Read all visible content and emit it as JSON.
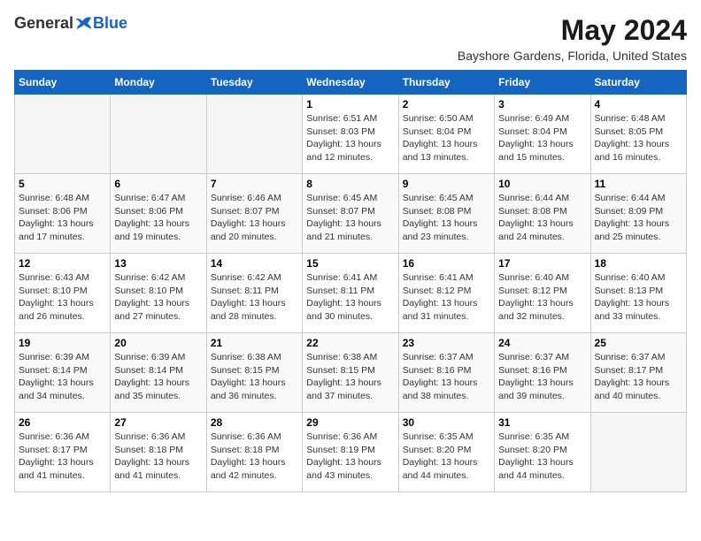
{
  "logo": {
    "general": "General",
    "blue": "Blue"
  },
  "title": "May 2024",
  "subtitle": "Bayshore Gardens, Florida, United States",
  "days_of_week": [
    "Sunday",
    "Monday",
    "Tuesday",
    "Wednesday",
    "Thursday",
    "Friday",
    "Saturday"
  ],
  "weeks": [
    [
      {
        "day": "",
        "info": ""
      },
      {
        "day": "",
        "info": ""
      },
      {
        "day": "",
        "info": ""
      },
      {
        "day": "1",
        "info": "Sunrise: 6:51 AM\nSunset: 8:03 PM\nDaylight: 13 hours and 12 minutes."
      },
      {
        "day": "2",
        "info": "Sunrise: 6:50 AM\nSunset: 8:04 PM\nDaylight: 13 hours and 13 minutes."
      },
      {
        "day": "3",
        "info": "Sunrise: 6:49 AM\nSunset: 8:04 PM\nDaylight: 13 hours and 15 minutes."
      },
      {
        "day": "4",
        "info": "Sunrise: 6:48 AM\nSunset: 8:05 PM\nDaylight: 13 hours and 16 minutes."
      }
    ],
    [
      {
        "day": "5",
        "info": "Sunrise: 6:48 AM\nSunset: 8:06 PM\nDaylight: 13 hours and 17 minutes."
      },
      {
        "day": "6",
        "info": "Sunrise: 6:47 AM\nSunset: 8:06 PM\nDaylight: 13 hours and 19 minutes."
      },
      {
        "day": "7",
        "info": "Sunrise: 6:46 AM\nSunset: 8:07 PM\nDaylight: 13 hours and 20 minutes."
      },
      {
        "day": "8",
        "info": "Sunrise: 6:45 AM\nSunset: 8:07 PM\nDaylight: 13 hours and 21 minutes."
      },
      {
        "day": "9",
        "info": "Sunrise: 6:45 AM\nSunset: 8:08 PM\nDaylight: 13 hours and 23 minutes."
      },
      {
        "day": "10",
        "info": "Sunrise: 6:44 AM\nSunset: 8:08 PM\nDaylight: 13 hours and 24 minutes."
      },
      {
        "day": "11",
        "info": "Sunrise: 6:44 AM\nSunset: 8:09 PM\nDaylight: 13 hours and 25 minutes."
      }
    ],
    [
      {
        "day": "12",
        "info": "Sunrise: 6:43 AM\nSunset: 8:10 PM\nDaylight: 13 hours and 26 minutes."
      },
      {
        "day": "13",
        "info": "Sunrise: 6:42 AM\nSunset: 8:10 PM\nDaylight: 13 hours and 27 minutes."
      },
      {
        "day": "14",
        "info": "Sunrise: 6:42 AM\nSunset: 8:11 PM\nDaylight: 13 hours and 28 minutes."
      },
      {
        "day": "15",
        "info": "Sunrise: 6:41 AM\nSunset: 8:11 PM\nDaylight: 13 hours and 30 minutes."
      },
      {
        "day": "16",
        "info": "Sunrise: 6:41 AM\nSunset: 8:12 PM\nDaylight: 13 hours and 31 minutes."
      },
      {
        "day": "17",
        "info": "Sunrise: 6:40 AM\nSunset: 8:12 PM\nDaylight: 13 hours and 32 minutes."
      },
      {
        "day": "18",
        "info": "Sunrise: 6:40 AM\nSunset: 8:13 PM\nDaylight: 13 hours and 33 minutes."
      }
    ],
    [
      {
        "day": "19",
        "info": "Sunrise: 6:39 AM\nSunset: 8:14 PM\nDaylight: 13 hours and 34 minutes."
      },
      {
        "day": "20",
        "info": "Sunrise: 6:39 AM\nSunset: 8:14 PM\nDaylight: 13 hours and 35 minutes."
      },
      {
        "day": "21",
        "info": "Sunrise: 6:38 AM\nSunset: 8:15 PM\nDaylight: 13 hours and 36 minutes."
      },
      {
        "day": "22",
        "info": "Sunrise: 6:38 AM\nSunset: 8:15 PM\nDaylight: 13 hours and 37 minutes."
      },
      {
        "day": "23",
        "info": "Sunrise: 6:37 AM\nSunset: 8:16 PM\nDaylight: 13 hours and 38 minutes."
      },
      {
        "day": "24",
        "info": "Sunrise: 6:37 AM\nSunset: 8:16 PM\nDaylight: 13 hours and 39 minutes."
      },
      {
        "day": "25",
        "info": "Sunrise: 6:37 AM\nSunset: 8:17 PM\nDaylight: 13 hours and 40 minutes."
      }
    ],
    [
      {
        "day": "26",
        "info": "Sunrise: 6:36 AM\nSunset: 8:17 PM\nDaylight: 13 hours and 41 minutes."
      },
      {
        "day": "27",
        "info": "Sunrise: 6:36 AM\nSunset: 8:18 PM\nDaylight: 13 hours and 41 minutes."
      },
      {
        "day": "28",
        "info": "Sunrise: 6:36 AM\nSunset: 8:18 PM\nDaylight: 13 hours and 42 minutes."
      },
      {
        "day": "29",
        "info": "Sunrise: 6:36 AM\nSunset: 8:19 PM\nDaylight: 13 hours and 43 minutes."
      },
      {
        "day": "30",
        "info": "Sunrise: 6:35 AM\nSunset: 8:20 PM\nDaylight: 13 hours and 44 minutes."
      },
      {
        "day": "31",
        "info": "Sunrise: 6:35 AM\nSunset: 8:20 PM\nDaylight: 13 hours and 44 minutes."
      },
      {
        "day": "",
        "info": ""
      }
    ]
  ]
}
